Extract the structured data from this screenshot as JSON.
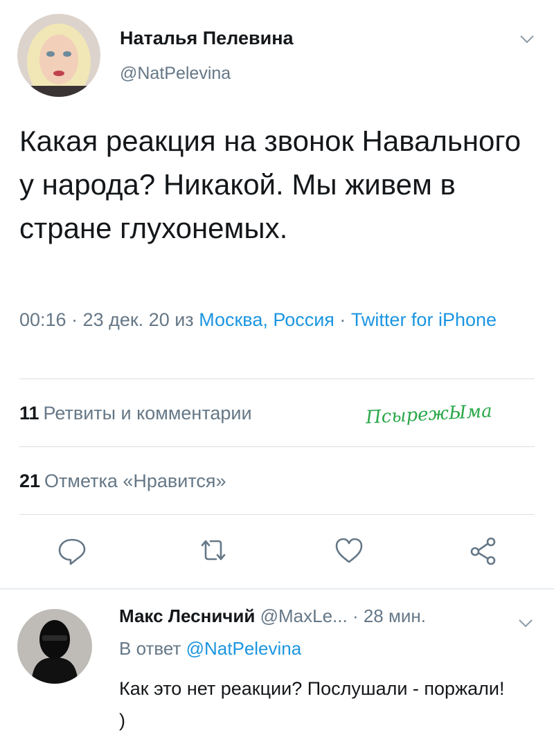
{
  "tweet": {
    "author_name": "Наталья Пелевина",
    "author_handle": "@NatPelevina",
    "text": "Какая реакция на звонок Навального у народа? Никакой. Мы живем в стране глухонемых.",
    "time": "00:16 · 23 дек. 20 из ",
    "location": "Москва, Россия",
    "sep": " · ",
    "source": "Twitter for iPhone",
    "retweets_count": "11",
    "retweets_label": "Ретвиты и комментарии",
    "likes_count": "21",
    "likes_label": "Отметка «Нравится»",
    "watermark": "ПсырежЫма"
  },
  "actions": [
    "reply-icon",
    "retweet-icon",
    "like-icon",
    "share-icon"
  ],
  "reply": {
    "author_name": "Макс Лесничий",
    "author_handle": "@MaxLe...",
    "time": "· 28 мин.",
    "in_reply_prefix": "В ответ ",
    "in_reply_handle": "@NatPelevina",
    "text": "Как это нет реакции? Послушали - поржали! )"
  },
  "colors": {
    "accent": "#1b95e0",
    "muted": "#657786",
    "text": "#14171a",
    "divider": "#d9dee3",
    "watermark": "#2aa84a"
  }
}
